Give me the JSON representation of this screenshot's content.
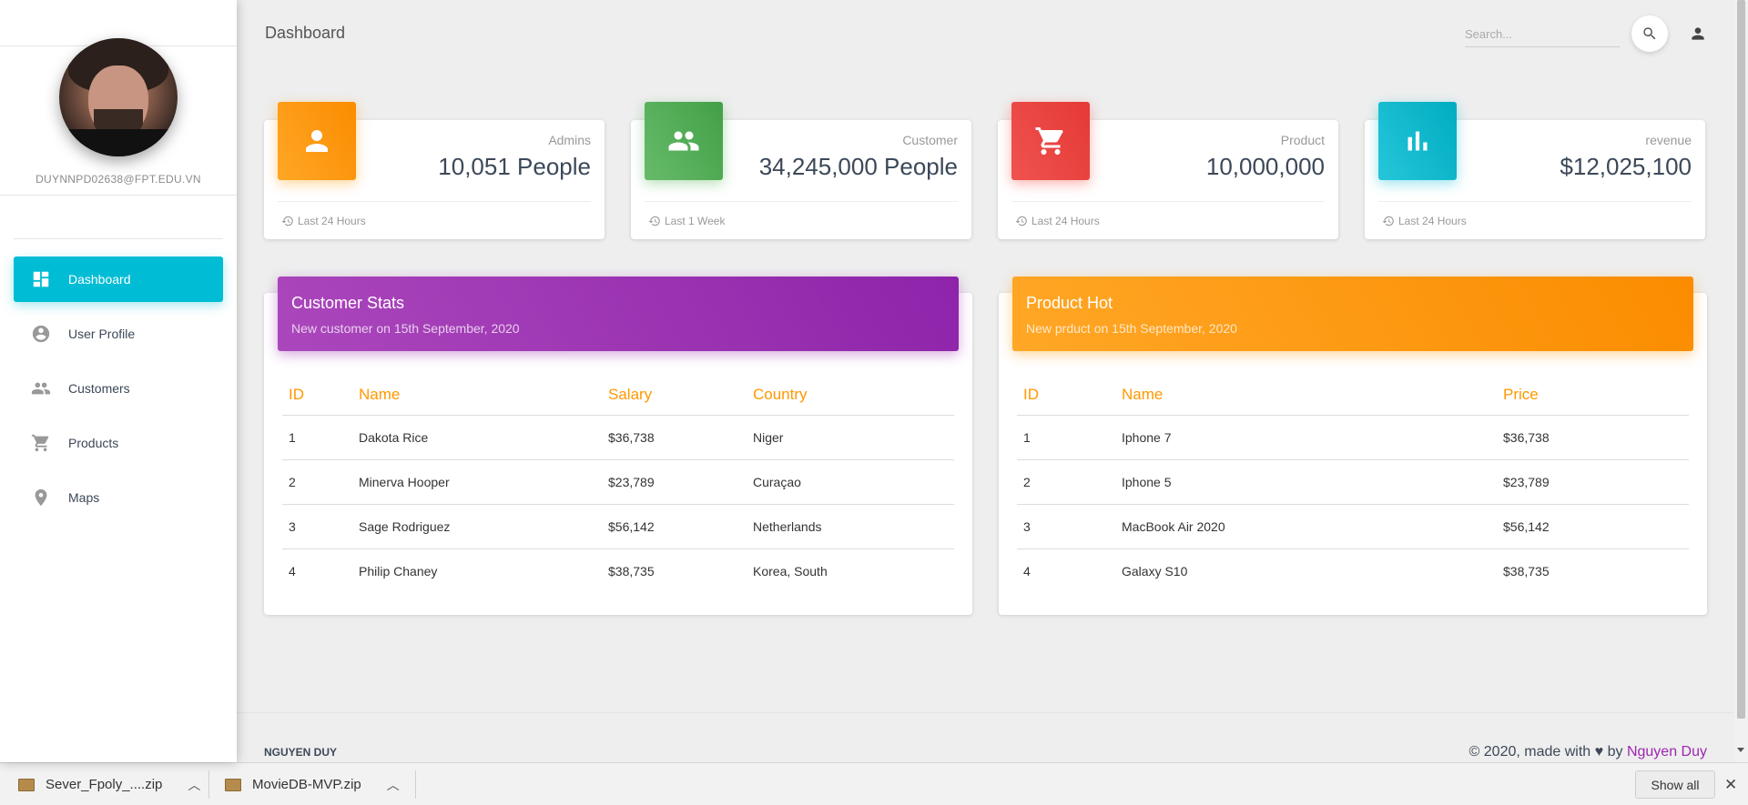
{
  "sidebar": {
    "email": "DUYNNPD02638@FPT.EDU.VN",
    "items": [
      {
        "label": "Dashboard",
        "icon": "dashboard-icon",
        "active": true
      },
      {
        "label": "User Profile",
        "icon": "account-circle-icon",
        "active": false
      },
      {
        "label": "Customers",
        "icon": "people-icon",
        "active": false
      },
      {
        "label": "Products",
        "icon": "cart-icon",
        "active": false
      },
      {
        "label": "Maps",
        "icon": "location-pin-icon",
        "active": false
      }
    ]
  },
  "header": {
    "title": "Dashboard",
    "search_placeholder": "Search..."
  },
  "stats": [
    {
      "label": "Admins",
      "value": "10,051 People",
      "footer": "Last 24 Hours",
      "color": "#ff9800",
      "icon": "person-icon"
    },
    {
      "label": "Customer",
      "value": "34,245,000 People",
      "footer": "Last 1 Week",
      "color": "#4caf50",
      "icon": "people-icon"
    },
    {
      "label": "Product",
      "value": "10,000,000",
      "footer": "Last 24 Hours",
      "color": "#f44336",
      "icon": "cart-icon"
    },
    {
      "label": "revenue",
      "value": "$12,025,100",
      "footer": "Last 24 Hours",
      "color": "#00bcd4",
      "icon": "bar-chart-icon"
    }
  ],
  "customer_stats": {
    "title": "Customer Stats",
    "subtitle": "New customer on 15th September, 2020",
    "color": "#9c27b0",
    "columns": [
      "ID",
      "Name",
      "Salary",
      "Country"
    ],
    "rows": [
      [
        "1",
        "Dakota Rice",
        "$36,738",
        "Niger"
      ],
      [
        "2",
        "Minerva Hooper",
        "$23,789",
        "Curaçao"
      ],
      [
        "3",
        "Sage Rodriguez",
        "$56,142",
        "Netherlands"
      ],
      [
        "4",
        "Philip Chaney",
        "$38,735",
        "Korea, South"
      ]
    ]
  },
  "product_hot": {
    "title": "Product Hot",
    "subtitle": "New prduct on 15th September, 2020",
    "color": "#ff9800",
    "columns": [
      "ID",
      "Name",
      "Price"
    ],
    "rows": [
      [
        "1",
        "Iphone 7",
        "$36,738"
      ],
      [
        "2",
        "Iphone 5",
        "$23,789"
      ],
      [
        "3",
        "MacBook Air 2020",
        "$56,142"
      ],
      [
        "4",
        "Galaxy S10",
        "$38,735"
      ]
    ]
  },
  "footer": {
    "left": "NGUYEN DUY",
    "right_prefix": "© 2020, made with",
    "heart": "♥",
    "by": "by",
    "author": "Nguyen Duy"
  },
  "downloads": {
    "items": [
      "Sever_Fpoly_....zip",
      "MovieDB-MVP.zip"
    ],
    "show_all": "Show all",
    "close": "✕"
  }
}
